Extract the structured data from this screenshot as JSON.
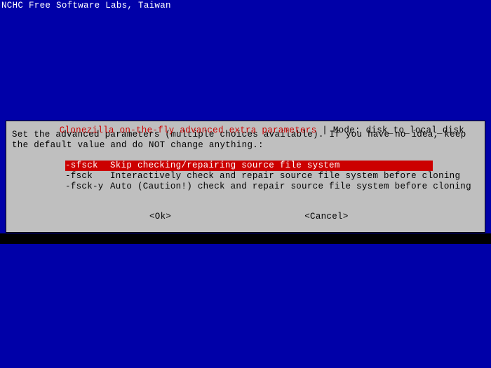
{
  "header": "NCHC Free Software Labs, Taiwan",
  "dialog": {
    "title_left": "Clonezilla on-the-fly advanced extra parameters",
    "title_sep": " | ",
    "title_right": "Mode: disk_to_local_disk",
    "instruction": "Set the advanced parameters (multiple choices available). If you have no idea, keep the default value and do NOT change anything.:",
    "options": [
      {
        "flag": "-sfsck",
        "desc": "Skip checking/repairing source file system",
        "selected": true
      },
      {
        "flag": "-fsck",
        "desc": "Interactively check and repair source file system before cloning",
        "selected": false
      },
      {
        "flag": "-fsck-y",
        "desc": "Auto (Caution!) check and repair source file system before cloning",
        "selected": false
      }
    ],
    "ok_label": "<Ok>",
    "cancel_label": "<Cancel>"
  }
}
